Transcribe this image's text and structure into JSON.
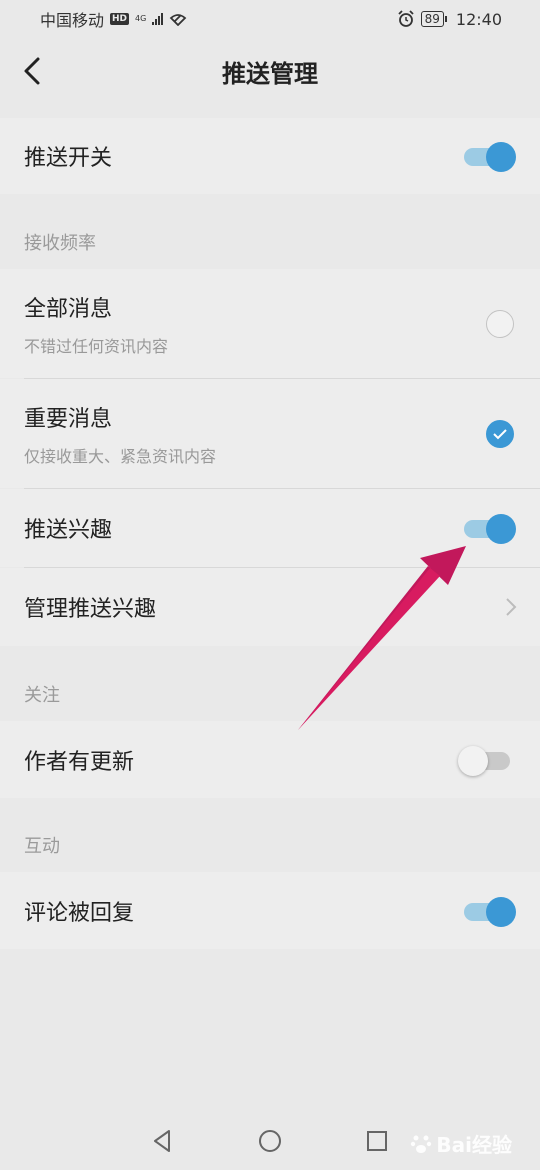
{
  "status_bar": {
    "carrier": "中国移动",
    "hd": "HD",
    "network": "4G",
    "battery": "89",
    "time": "12:40"
  },
  "header": {
    "title": "推送管理"
  },
  "push_switch": {
    "label": "推送开关",
    "on": true
  },
  "frequency": {
    "section_title": "接收频率",
    "all": {
      "label": "全部消息",
      "subtitle": "不错过任何资讯内容",
      "checked": false
    },
    "important": {
      "label": "重要消息",
      "subtitle": "仅接收重大、紧急资讯内容",
      "checked": true
    }
  },
  "interest": {
    "label": "推送兴趣",
    "on": true
  },
  "manage_interest": {
    "label": "管理推送兴趣"
  },
  "follow": {
    "section_title": "关注",
    "author_update": {
      "label": "作者有更新",
      "on": false
    }
  },
  "interaction": {
    "section_title": "互动",
    "comment_reply": {
      "label": "评论被回复",
      "on": true
    }
  },
  "watermark": {
    "text": "Bai经验"
  },
  "colors": {
    "accent": "#3b98d5",
    "accent_light": "#9ccbe4",
    "background": "#e9e9e9",
    "annotation_arrow": "#c2185b"
  }
}
